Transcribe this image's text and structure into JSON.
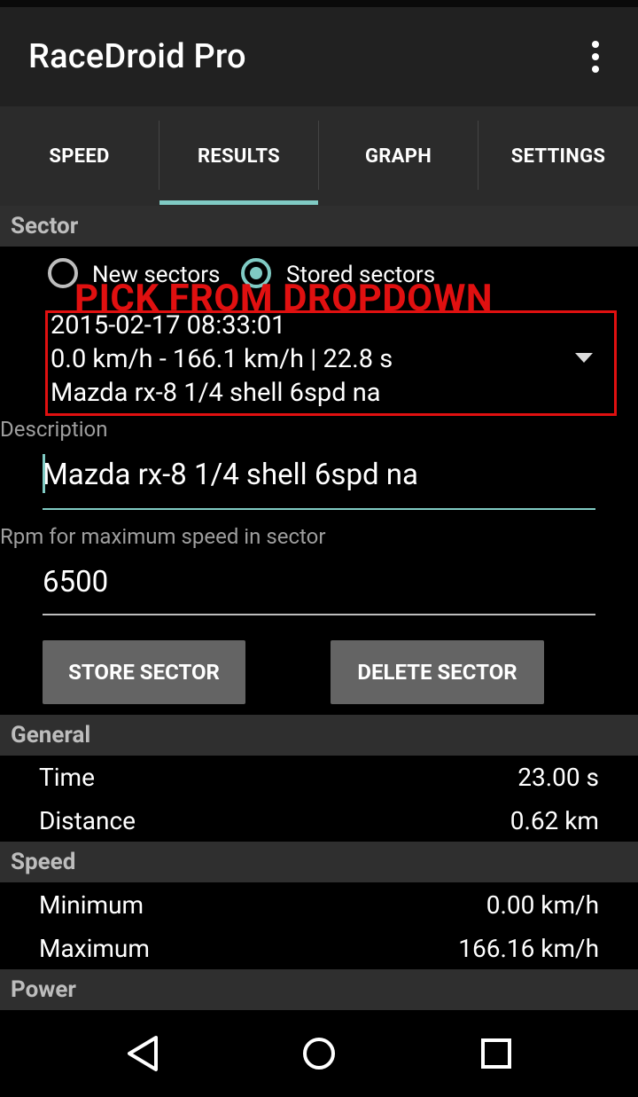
{
  "app": {
    "title": "RaceDroid Pro"
  },
  "tabs": [
    {
      "label": "SPEED",
      "selected": false
    },
    {
      "label": "RESULTS",
      "selected": true
    },
    {
      "label": "GRAPH",
      "selected": false
    },
    {
      "label": "SETTINGS",
      "selected": false
    }
  ],
  "sector": {
    "header": "Sector",
    "radios": [
      {
        "label": "New sectors",
        "checked": false
      },
      {
        "label": "Stored sectors",
        "checked": true
      }
    ],
    "annotation": "PICK FROM DROPDOWN",
    "dropdown": {
      "line1": "2015-02-17 08:33:01",
      "line2": "0.0 km/h - 166.1 km/h | 22.8 s",
      "line3": "Mazda rx-8 1/4 shell 6spd na"
    },
    "description": {
      "label": "Description",
      "value": "Mazda rx-8 1/4 shell 6spd na"
    },
    "rpm": {
      "label": "Rpm for maximum speed in sector",
      "value": "6500"
    },
    "store_button": "STORE SECTOR",
    "delete_button": "DELETE SECTOR"
  },
  "general": {
    "header": "General",
    "rows": [
      {
        "label": "Time",
        "value": "23.00 s"
      },
      {
        "label": "Distance",
        "value": "0.62 km"
      }
    ]
  },
  "speed": {
    "header": "Speed",
    "rows": [
      {
        "label": "Minimum",
        "value": "0.00 km/h"
      },
      {
        "label": "Maximum",
        "value": "166.16 km/h"
      }
    ]
  },
  "power": {
    "header": "Power"
  },
  "colors": {
    "accent": "#80cbc4",
    "annotation": "#e01010",
    "appbar": "#212121",
    "tabs": "#2b2b2b"
  },
  "icons": [
    "overflow-menu-icon",
    "nav-back-icon",
    "nav-home-icon",
    "nav-recents-icon",
    "dropdown-caret-icon"
  ]
}
